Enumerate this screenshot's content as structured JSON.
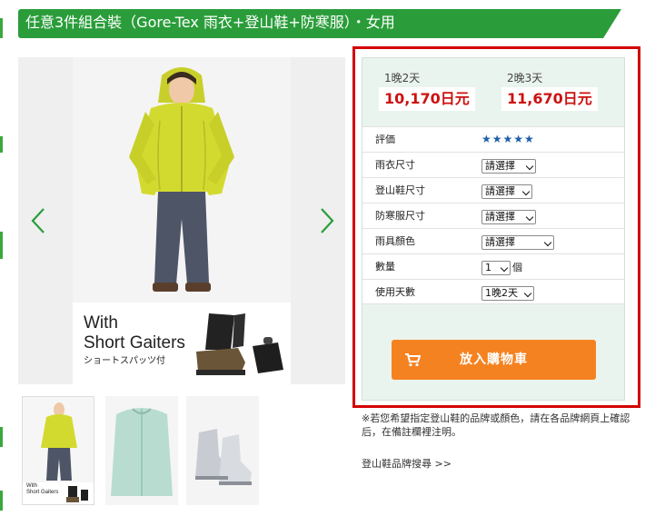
{
  "header": {
    "title": "任意3件組合裝（Gore-Tex 雨衣+登山鞋+防寒服）・女用"
  },
  "gallery": {
    "promo_line1": "With",
    "promo_line2": "Short Gaiters",
    "promo_line3": "ショートスパッツ付",
    "thumb1_promo_line1": "With",
    "thumb1_promo_line2": "Short Gaiters"
  },
  "pricing": {
    "plan1_label": "1晚2天",
    "plan1_price": "10,170日元",
    "plan2_label": "2晚3天",
    "plan2_price": "11,670日元"
  },
  "options": {
    "rating_label": "評価",
    "rating_value": 5,
    "rating_display": "★★★★★",
    "raincoat_label": "雨衣尺寸",
    "raincoat_value": "請選擇",
    "shoes_label": "登山鞋尺寸",
    "shoes_value": "請選擇",
    "coldwear_label": "防寒服尺寸",
    "coldwear_value": "請選擇",
    "raincolor_label": "雨具顏色",
    "raincolor_value": "請選擇",
    "qty_label": "數量",
    "qty_value": "1",
    "qty_unit": "個",
    "days_label": "使用天數",
    "days_value": "1晚2天"
  },
  "cart": {
    "label": "放入購物車"
  },
  "note": "※若您希望指定登山鞋的品牌或顏色，請在各品牌網頁上確認后，在備註欄裡注明。",
  "brand_link": "登山鞋品牌搜尋 >>",
  "colors": {
    "brand_green": "#2a9d3a",
    "price_red": "#cc1111",
    "cart_orange": "#f58220",
    "frame_red": "#d40000"
  }
}
